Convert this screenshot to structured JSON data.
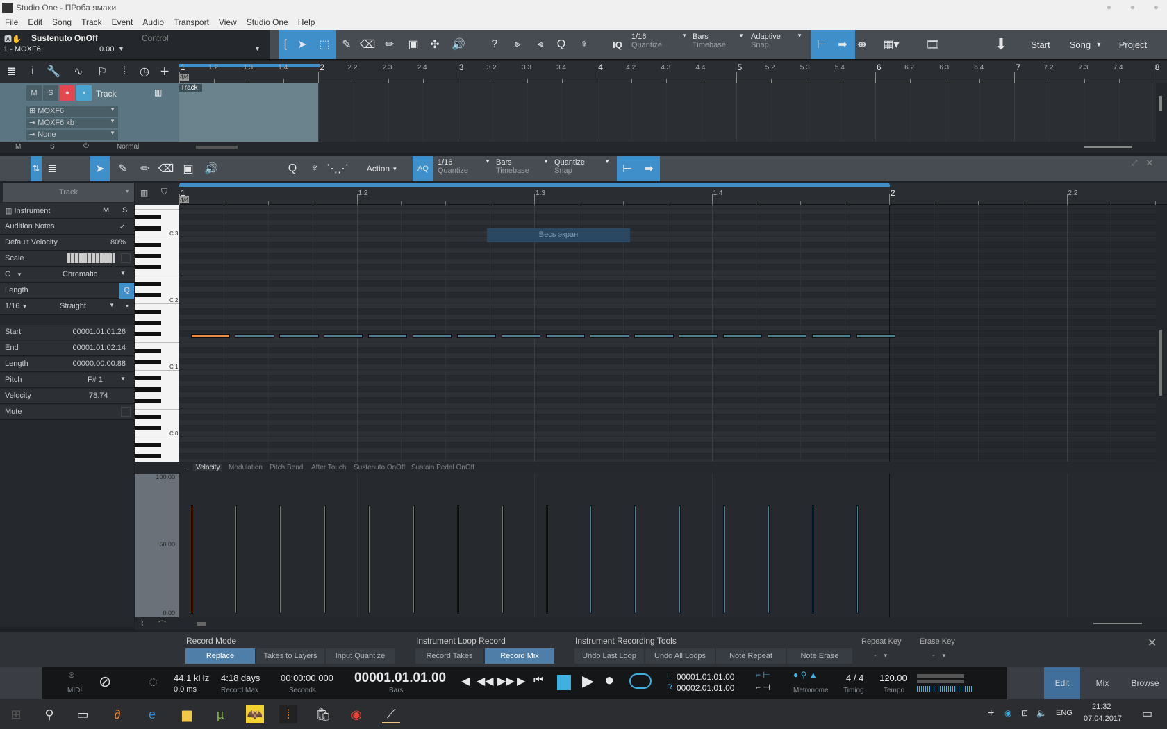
{
  "window": {
    "title": "Studio One - ПРоба ямахи"
  },
  "menu": [
    "File",
    "Edit",
    "Song",
    "Track",
    "Event",
    "Audio",
    "Transport",
    "View",
    "Studio One",
    "Help"
  ],
  "header": {
    "param_name": "Sustenuto OnOff",
    "param_type": "Control",
    "device": "1 - MOXF6",
    "value": "0.00"
  },
  "toolbar": {
    "quantize": {
      "value": "1/16",
      "label": "Quantize"
    },
    "timebase": {
      "value": "Bars",
      "label": "Timebase"
    },
    "snap": {
      "value": "Adaptive",
      "label": "Snap"
    },
    "iq": "IQ",
    "help": "?",
    "start": "Start",
    "song": "Song",
    "project": "Project"
  },
  "arrange": {
    "ruler": [
      "1",
      "1.2",
      "1.3",
      "1.4",
      "2",
      "2.2",
      "2.3",
      "2.4",
      "3",
      "3.2",
      "3.3",
      "3.4",
      "4",
      "4.2",
      "4.3",
      "4.4",
      "5",
      "5.2",
      "5.3",
      "5.4",
      "6",
      "6.2",
      "6.3",
      "6.4",
      "7",
      "7.2",
      "7.3",
      "7.4",
      "8"
    ],
    "signature": "4/4",
    "track": {
      "mute": "M",
      "solo": "S",
      "name": "Track",
      "event_label": "Track",
      "instrument": "MOXF6",
      "input": "MOXF6 kb",
      "output": "None"
    },
    "footer": {
      "m": "M",
      "s": "S",
      "mode": "Normal"
    }
  },
  "editor": {
    "toolbar": {
      "action": "Action",
      "aq": "AQ",
      "quantize": {
        "value": "1/16",
        "label": "Quantize"
      },
      "timebase": {
        "value": "Bars",
        "label": "Timebase"
      },
      "snap": {
        "value": "Quantize",
        "label": "Snap"
      }
    },
    "ruler": [
      "1",
      "1.2",
      "1.3",
      "1.4",
      "2",
      "2.2"
    ],
    "signature": "4/4",
    "overlay_text": "Весь экран",
    "inspector": {
      "track": "Track",
      "instrument": "Instrument",
      "m": "M",
      "s": "S",
      "audition_notes": "Audition Notes",
      "default_velocity_label": "Default Velocity",
      "default_velocity": "80%",
      "scale_label": "Scale",
      "root": "C",
      "scale": "Chromatic",
      "length_label": "Length",
      "q": "Q",
      "length_value": "1/16",
      "length_mode": "Straight",
      "start_label": "Start",
      "start": "00001.01.01.26",
      "end_label": "End",
      "end": "00001.01.02.14",
      "nlength_label": "Length",
      "nlength": "00000.00.00.88",
      "pitch_label": "Pitch",
      "pitch": "F# 1",
      "velocity_label": "Velocity",
      "velocity": "78.74",
      "mute_label": "Mute"
    },
    "keys": {
      "c3": "C 3",
      "c2": "C 2",
      "c1": "C 1",
      "c0": "C 0"
    },
    "notes": {
      "pitch": "F# 1",
      "count": 16,
      "start_offset_ticks": 26,
      "length_ticks": 88,
      "selected_index": 0,
      "velocity": 78.74
    },
    "controller_tabs": [
      "...",
      "Velocity",
      "Modulation",
      "Pitch Bend",
      "After Touch",
      "Sustenuto OnOff",
      "Sustain Pedal OnOff"
    ],
    "velocity_axis": [
      "100.00",
      "50.00",
      "0.00"
    ]
  },
  "record_panel": {
    "record_mode": "Record Mode",
    "modes": [
      "Replace",
      "Takes to Layers",
      "Input Quantize"
    ],
    "loop_title": "Instrument Loop Record",
    "loop": [
      "Record Takes",
      "Record Mix"
    ],
    "tools_title": "Instrument Recording Tools",
    "tools": [
      "Undo Last Loop",
      "Undo All Loops",
      "Note Repeat",
      "Note Erase"
    ],
    "repeat_key": "Repeat Key",
    "repeat_val": "-",
    "erase_key": "Erase Key",
    "erase_val": "-"
  },
  "transport": {
    "midi": "MIDI",
    "rate": "44.1 kHz",
    "latency": "0.0 ms",
    "record_max": "4:18 days",
    "record_max_label": "Record Max",
    "seconds": "00:00:00.000",
    "seconds_label": "Seconds",
    "bars": "00001.01.01.00",
    "bars_label": "Bars",
    "l": "L",
    "left": "00001.01.01.00",
    "r": "R",
    "right": "00002.01.01.00",
    "metronome": "Metronome",
    "timing": "4 / 4",
    "timing_label": "Timing",
    "tempo": "120.00",
    "tempo_label": "Tempo",
    "edit": "Edit",
    "mix": "Mix",
    "browse": "Browse"
  },
  "taskbar": {
    "lang": "ENG",
    "time": "21:32",
    "date": "07.04.2017"
  },
  "colors": {
    "accent": "#3f8fca",
    "note": "#4e7d8d",
    "selected_note": "#e8904a",
    "record": "#e5474f"
  }
}
